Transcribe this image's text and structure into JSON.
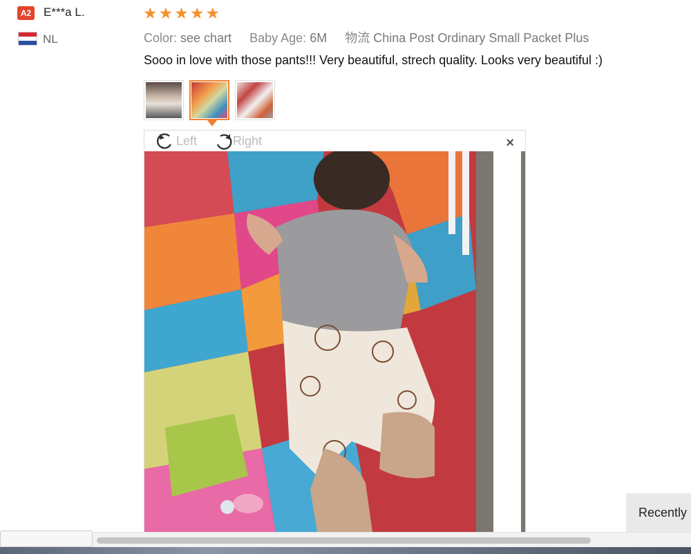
{
  "buyer": {
    "badge": "A2",
    "name": "E***a L.",
    "country": "NL"
  },
  "rating": {
    "stars": 5,
    "max": 5
  },
  "meta": {
    "color_label": "Color:",
    "color_value": "see chart",
    "age_label": "Baby Age:",
    "age_value": "6M",
    "shipping_label": "物流",
    "shipping_value": "China Post Ordinary Small Packet Plus"
  },
  "review_text": "Sooo in love with those pants!!! Very beautiful, strech quality. Looks very beautiful :)",
  "thumbnails": [
    {
      "name": "review-photo-1",
      "active": false
    },
    {
      "name": "review-photo-2",
      "active": true
    },
    {
      "name": "review-photo-3",
      "active": false
    }
  ],
  "viewer": {
    "rotate_left_label": "Left",
    "rotate_right_label": "Right",
    "close_glyph": "×"
  },
  "recently_tab": "Recently",
  "colors": {
    "accent": "#f08132",
    "star": "#f5922d",
    "badge": "#e2452e"
  }
}
